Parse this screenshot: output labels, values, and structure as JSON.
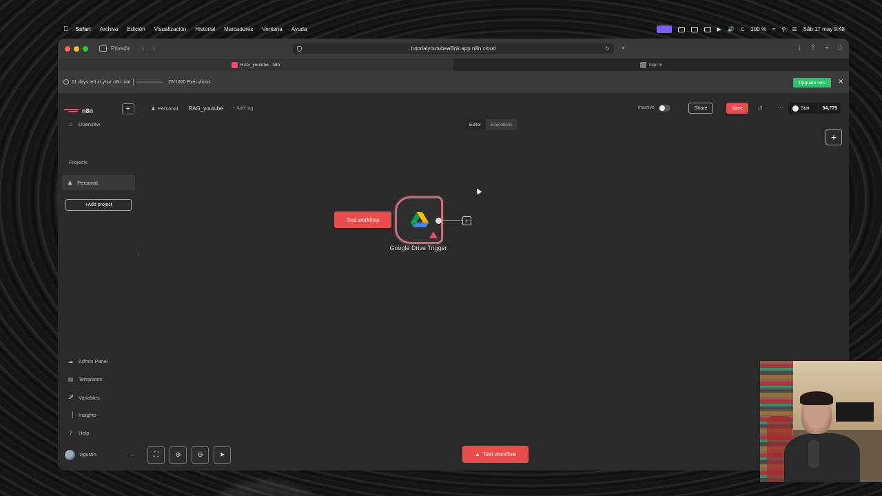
{
  "menubar": {
    "apple": "",
    "items": [
      "Safari",
      "Archivo",
      "Edición",
      "Visualización",
      "Historial",
      "Marcadores",
      "Ventana",
      "Ayuda"
    ],
    "battery": "100 %",
    "clock": "Sáb 17 may 9:48"
  },
  "browser": {
    "private_label": "Privada",
    "url": "tutorialyoutubeailink.app.n8n.cloud",
    "tabs": [
      {
        "label": "RAG_youtube - n8n",
        "active": true
      },
      {
        "label": "Sign in",
        "active": false
      }
    ]
  },
  "banner": {
    "trial_text": "11 days left in your n8n trial",
    "executions_text": "25/1000 Executions",
    "executions_used": 25,
    "executions_limit": 1000,
    "upgrade_label": "Upgrade now",
    "upgrade_color": "#2ec06b"
  },
  "sidebar": {
    "logo": "n8n",
    "overview": "Overview",
    "projects_label": "Projects",
    "personal": "Personal",
    "add_project": "+Add project",
    "bottom_items": [
      {
        "label": "Admin Panel",
        "icon": "cloud-icon"
      },
      {
        "label": "Templates",
        "icon": "templates-icon"
      },
      {
        "label": "Variables",
        "icon": "variables-icon"
      },
      {
        "label": "Insights",
        "icon": "insights-icon"
      },
      {
        "label": "Help",
        "icon": "help-icon"
      }
    ],
    "user_name": "Agustín"
  },
  "header": {
    "crumb_personal": "Personal",
    "workflow_name": "RAG_youtube",
    "add_tag": "+ Add tag",
    "inactive_label": "Inactive",
    "share_label": "Share",
    "save_label": "Save",
    "star_label": "Star",
    "star_count": "94,779",
    "tabs": [
      {
        "label": "Editor",
        "active": true
      },
      {
        "label": "Executions",
        "active": false
      }
    ]
  },
  "canvas": {
    "test_workflow_inline": "Test workflow",
    "node_label": "Google Drive Trigger",
    "test_workflow_bottom": "Test workflow",
    "accent_color": "#ea4b4b"
  }
}
